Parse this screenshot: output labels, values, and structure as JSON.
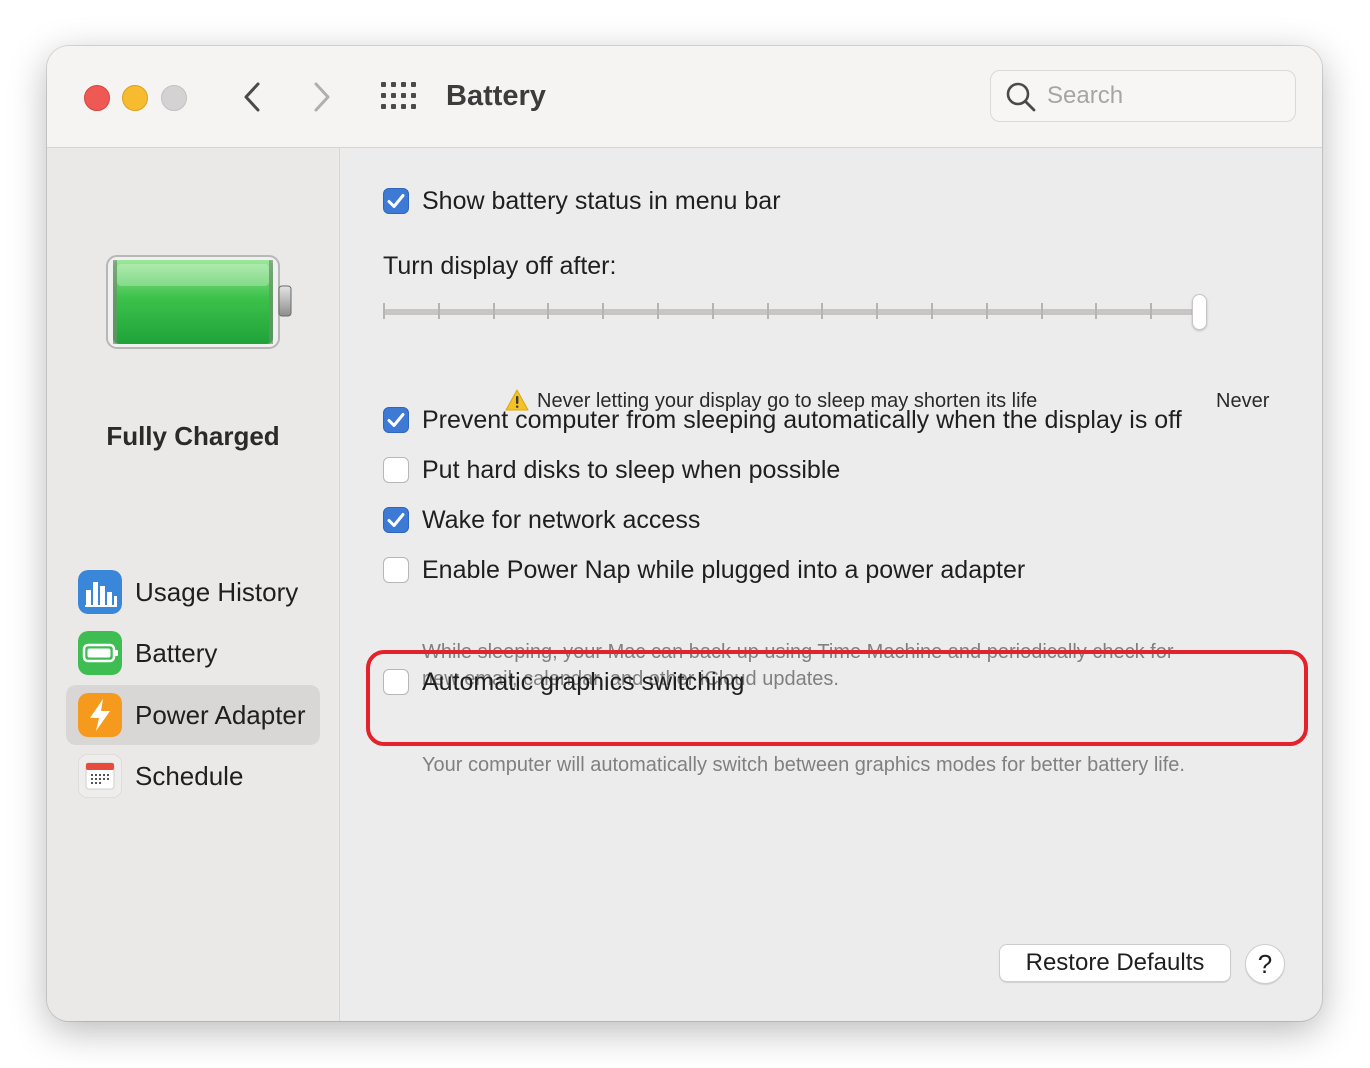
{
  "window": {
    "title": "Battery",
    "search": {
      "placeholder": "Search",
      "value": ""
    }
  },
  "sidebar": {
    "status": "Fully Charged",
    "items": [
      {
        "label": "Usage History",
        "icon": "chart-icon",
        "selected": false
      },
      {
        "label": "Battery",
        "icon": "battery-icon",
        "selected": false
      },
      {
        "label": "Power Adapter",
        "icon": "lightning-icon",
        "selected": true
      },
      {
        "label": "Schedule",
        "icon": "calendar-icon",
        "selected": false
      }
    ]
  },
  "settings": {
    "show_status": {
      "label": "Show battery status in menu bar",
      "checked": true
    },
    "display_off": {
      "label": "Turn display off after:",
      "value": "Never",
      "tick_count": 16,
      "position": 1.0,
      "warning": "Never letting your display go to sleep may shorten its life",
      "end_label": "Never"
    },
    "prevent_sleep": {
      "label": "Prevent computer from sleeping automatically when the display is off",
      "checked": true
    },
    "hard_disks": {
      "label": "Put hard disks to sleep when possible",
      "checked": false
    },
    "wake_network": {
      "label": "Wake for network access",
      "checked": true
    },
    "power_nap": {
      "label": "Enable Power Nap while plugged into a power adapter",
      "checked": false,
      "description_1": "While sleeping, your Mac can back up using Time Machine and periodically check for",
      "description_2": "new email, calendar, and other iCloud updates."
    },
    "graphics_switching": {
      "label": "Automatic graphics switching",
      "checked": false,
      "description": "Your computer will automatically switch between graphics modes for better battery life."
    }
  },
  "footer": {
    "restore_label": "Restore Defaults",
    "help_label": "?"
  },
  "colors": {
    "accent": "#3d7ad6",
    "highlight": "#e3222b",
    "close": "#ee5a53",
    "minimize": "#f6bb2e"
  }
}
